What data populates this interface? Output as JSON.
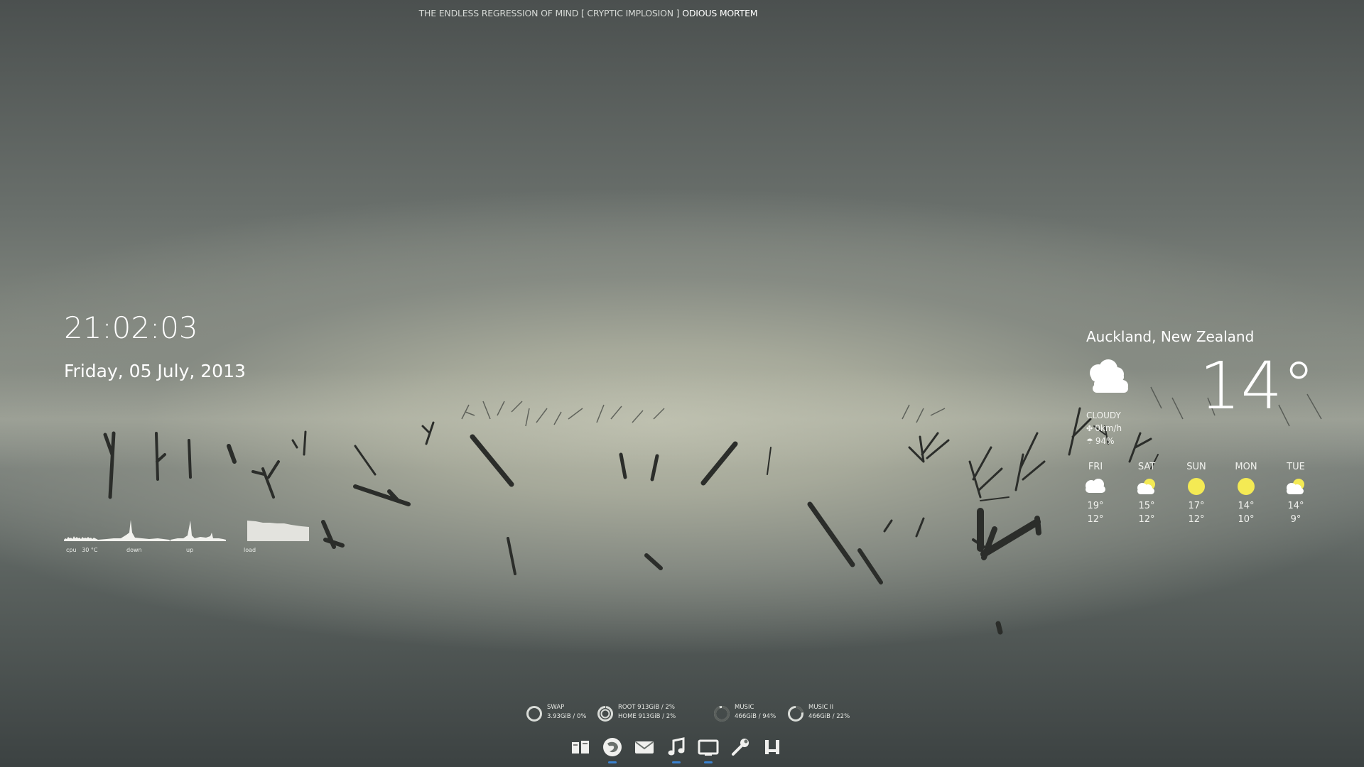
{
  "now_playing": {
    "track": "THE ENDLESS REGRESSION OF MIND [ CRYPTIC IMPLOSION ]",
    "artist": "ODIOUS MORTEM"
  },
  "clock": {
    "time": "21:02:03",
    "date": "Friday, 05 July, 2013"
  },
  "system_graphs": {
    "labels": {
      "cpu": "cpu",
      "temp": "30 °C",
      "down": "down",
      "up": "up",
      "load": "load"
    }
  },
  "weather": {
    "location": "Auckland, New Zealand",
    "temperature": "14°",
    "condition": "CLOUDY",
    "wind": "0km/h",
    "humidity": "94%",
    "main_icon": "cloudy-icon",
    "forecast": [
      {
        "day": "FRI",
        "icon": "cloudy-icon",
        "high": "19°",
        "low": "12°"
      },
      {
        "day": "SAT",
        "icon": "partly-cloudy-icon",
        "high": "15°",
        "low": "12°"
      },
      {
        "day": "SUN",
        "icon": "sunny-icon",
        "high": "17°",
        "low": "12°"
      },
      {
        "day": "MON",
        "icon": "sunny-icon",
        "high": "14°",
        "low": "10°"
      },
      {
        "day": "TUE",
        "icon": "partly-cloudy-icon",
        "high": "14°",
        "low": "9°"
      }
    ]
  },
  "disks": [
    {
      "name": "SWAP",
      "line1": "SWAP",
      "line2": "3.93GiB / 0%",
      "percent": 0
    },
    {
      "name": "ROOT/HOME",
      "line1": "ROOT  913GiB / 2%",
      "line2": "HOME  913GiB / 2%",
      "percent": 2
    },
    {
      "name": "MUSIC",
      "line1": "MUSIC",
      "line2": "466GiB / 94%",
      "percent": 94
    },
    {
      "name": "MUSIC II",
      "line1": "MUSIC II",
      "line2": "466GiB / 22%",
      "percent": 22
    }
  ],
  "dock": [
    {
      "name": "file-manager-icon",
      "active": false
    },
    {
      "name": "firefox-icon",
      "active": true
    },
    {
      "name": "mail-icon",
      "active": false
    },
    {
      "name": "music-player-icon",
      "active": true
    },
    {
      "name": "terminal-icon",
      "active": true
    },
    {
      "name": "settings-wrench-icon",
      "active": false
    },
    {
      "name": "torrent-client-icon",
      "active": false
    }
  ],
  "colors": {
    "text": "#ffffff",
    "sun": "#f4ea54",
    "dock_indicator": "#3b82d0"
  }
}
